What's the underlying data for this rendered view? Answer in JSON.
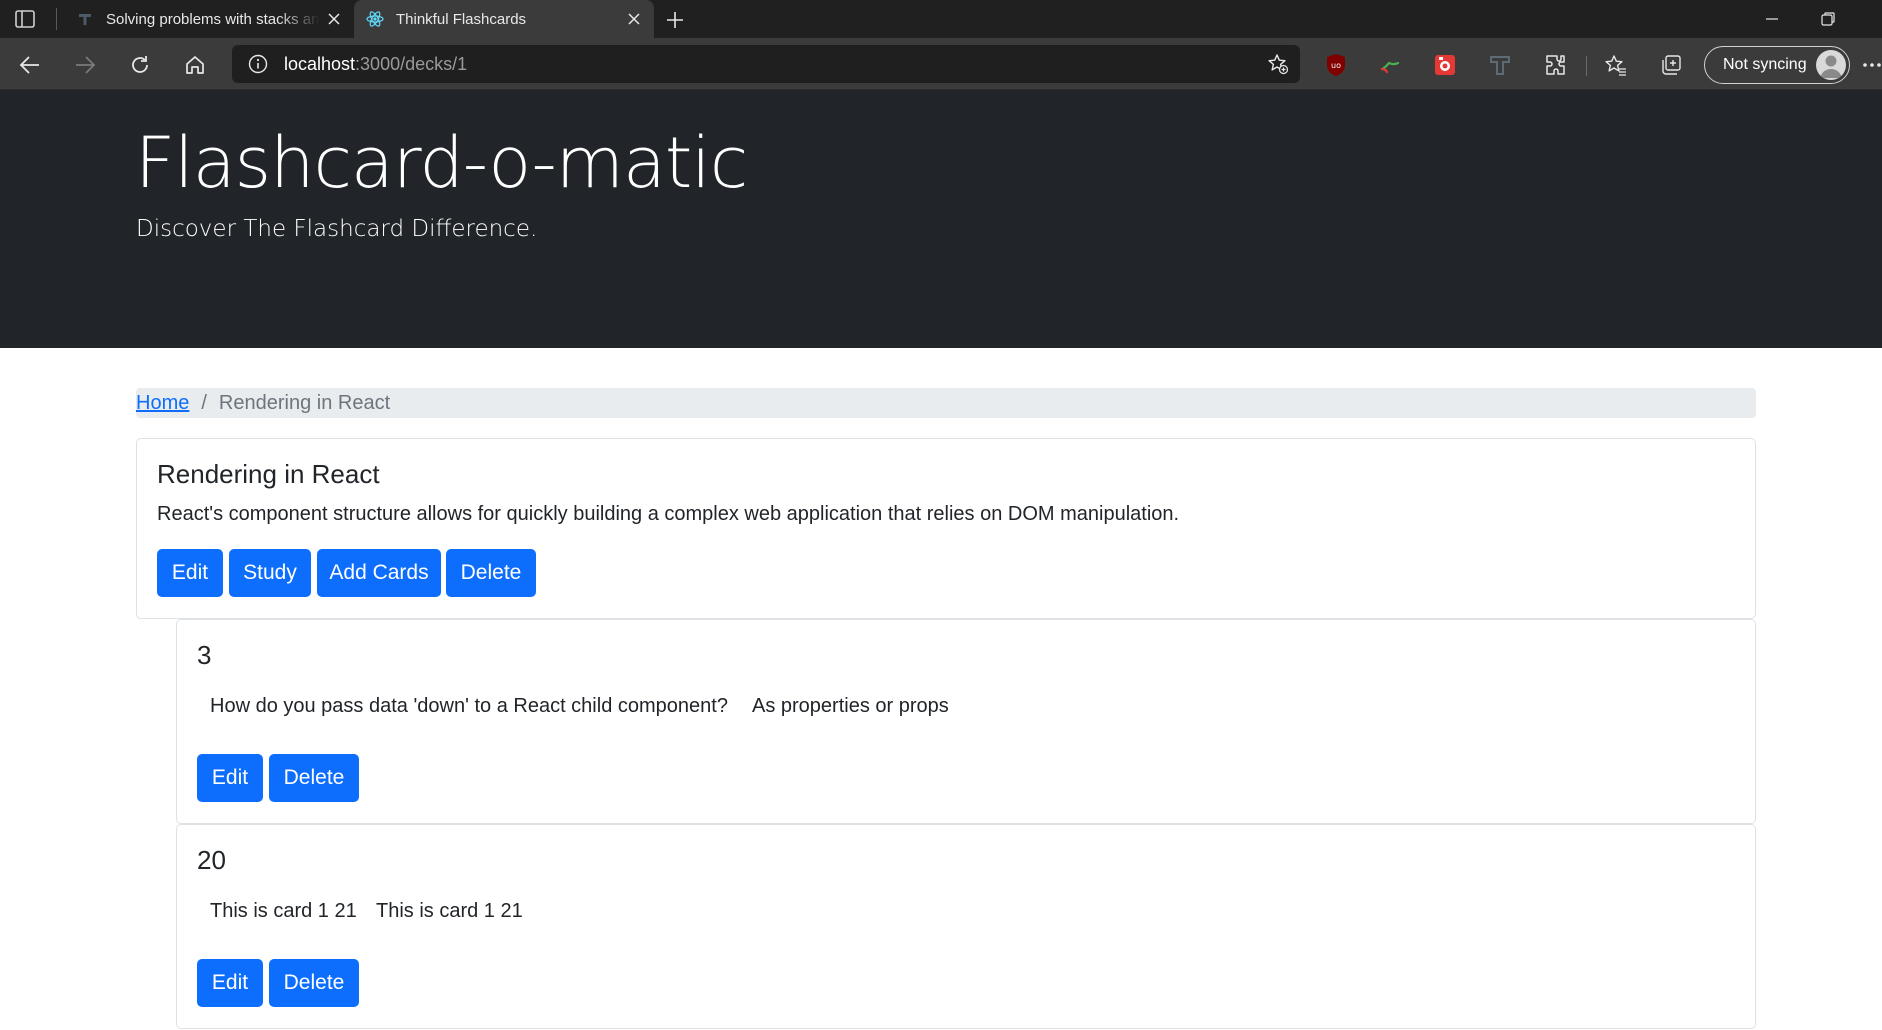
{
  "browser": {
    "tabs": [
      {
        "title": "Solving problems with stacks and queues",
        "favicon": "thinkful-favicon-icon",
        "active": false
      },
      {
        "title": "Thinkful Flashcards",
        "favicon": "react-favicon-icon",
        "active": true
      }
    ],
    "address": {
      "host": "localhost",
      "path": ":3000/decks/1"
    },
    "sync_label": "Not syncing",
    "icons": [
      "tab-actions-icon",
      "close-icon",
      "plus-icon",
      "minimize-icon",
      "restore-icon",
      "back-icon",
      "forward-icon",
      "refresh-icon",
      "home-icon",
      "info-icon",
      "favorite-add-icon",
      "ublock-icon",
      "extension-icon",
      "extensions-icon",
      "favorites-icon",
      "collections-icon",
      "avatar-icon",
      "more-icon"
    ]
  },
  "header": {
    "title": "Flashcard-o-matic",
    "lead": "Discover The Flashcard Difference."
  },
  "breadcrumb": {
    "home": "Home",
    "separator": "/",
    "current": "Rendering in React"
  },
  "deck": {
    "name": "Rendering in React",
    "description": "React's component structure allows for quickly building a complex web application that relies on DOM manipulation.",
    "buttons": {
      "edit": "Edit",
      "study": "Study",
      "add_cards": "Add Cards",
      "delete": "Delete"
    }
  },
  "cards": [
    {
      "id": "3",
      "front": "How do you pass data 'down' to a React child component?",
      "back": "As properties or props",
      "edit": "Edit",
      "delete": "Delete"
    },
    {
      "id": "20",
      "front": "This is card 1 21",
      "back": "This is card 1 21",
      "edit": "Edit",
      "delete": "Delete"
    }
  ],
  "colors": {
    "primary": "#0d6efd",
    "header_bg": "#212529",
    "breadcrumb_bg": "#e9ecef",
    "chrome_tabbar": "#202020",
    "chrome_toolbar": "#3b3b3b"
  }
}
